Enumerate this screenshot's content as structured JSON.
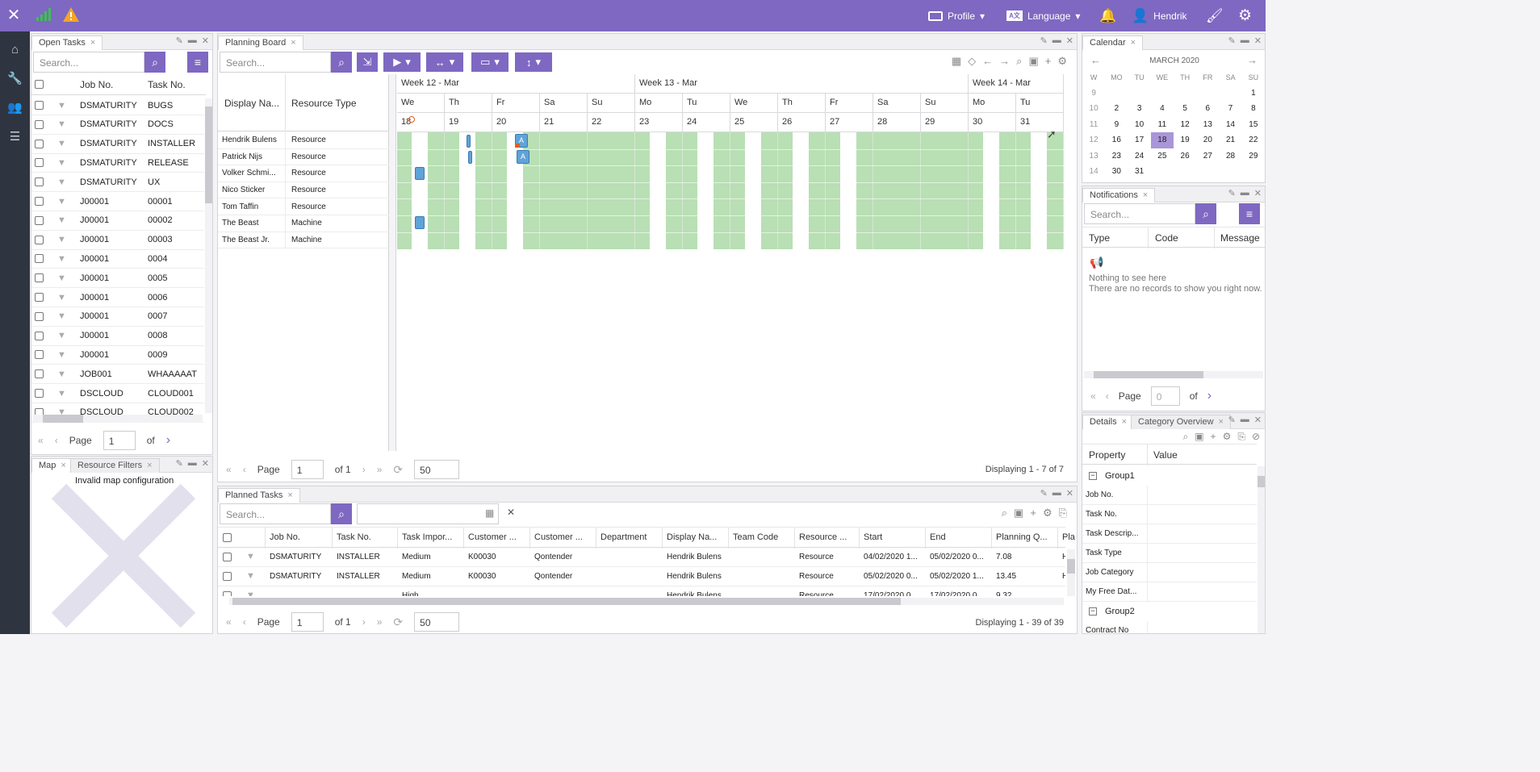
{
  "topbar": {
    "profile": "Profile",
    "language": "Language",
    "user": "Hendrik",
    "accent": "#7e68c2"
  },
  "open_tasks": {
    "title": "Open Tasks",
    "search_placeholder": "Search...",
    "columns": [
      "Job No.",
      "Task No."
    ],
    "rows": [
      [
        "DSMATURITY",
        "BUGS"
      ],
      [
        "DSMATURITY",
        "DOCS"
      ],
      [
        "DSMATURITY",
        "INSTALLER"
      ],
      [
        "DSMATURITY",
        "RELEASE"
      ],
      [
        "DSMATURITY",
        "UX"
      ],
      [
        "J00001",
        "00001"
      ],
      [
        "J00001",
        "00002"
      ],
      [
        "J00001",
        "00003"
      ],
      [
        "J00001",
        "0004"
      ],
      [
        "J00001",
        "0005"
      ],
      [
        "J00001",
        "0006"
      ],
      [
        "J00001",
        "0007"
      ],
      [
        "J00001",
        "0008"
      ],
      [
        "J00001",
        "0009"
      ],
      [
        "JOB001",
        "WHAAAAAT"
      ],
      [
        "DSCLOUD",
        "CLOUD001"
      ],
      [
        "DSCLOUD",
        "CLOUD002"
      ]
    ],
    "pager": {
      "page_label": "Page",
      "page": "1",
      "of": "of"
    }
  },
  "map": {
    "tab1": "Map",
    "tab2": "Resource Filters",
    "message": "Invalid map configuration"
  },
  "planning": {
    "title": "Planning Board",
    "search_placeholder": "Search...",
    "col_display": "Display Na...",
    "col_type": "Resource Type",
    "weeks": [
      "Week 12 - Mar",
      "Week 13 - Mar",
      "Week 14 - Mar"
    ],
    "days": [
      "We",
      "Th",
      "Fr",
      "Sa",
      "Su",
      "Mo",
      "Tu",
      "We",
      "Th",
      "Fr",
      "Sa",
      "Su",
      "Mo",
      "Tu"
    ],
    "dates": [
      "18",
      "19",
      "20",
      "21",
      "22",
      "23",
      "24",
      "25",
      "26",
      "27",
      "28",
      "29",
      "30",
      "31"
    ],
    "resources": [
      [
        "Hendrik Bulens",
        "Resource"
      ],
      [
        "Patrick Nijs",
        "Resource"
      ],
      [
        "Volker Schmi...",
        "Resource"
      ],
      [
        "Nico Sticker",
        "Resource"
      ],
      [
        "Tom Taffin",
        "Resource"
      ],
      [
        "The Beast",
        "Machine"
      ],
      [
        "The Beast Jr.",
        "Machine"
      ]
    ],
    "pager": {
      "page_label": "Page",
      "page": "1",
      "of": "of 1",
      "size": "50",
      "status": "Displaying 1 - 7 of 7"
    },
    "block_label": "A"
  },
  "calendar": {
    "title": "Calendar",
    "month": "MARCH 2020",
    "dow": [
      "W",
      "MO",
      "TU",
      "WE",
      "TH",
      "FR",
      "SA",
      "SU"
    ],
    "weeks": [
      [
        "9",
        "",
        "",
        "",
        "",
        "",
        "",
        "1"
      ],
      [
        "10",
        "2",
        "3",
        "4",
        "5",
        "6",
        "7",
        "8"
      ],
      [
        "11",
        "9",
        "10",
        "11",
        "12",
        "13",
        "14",
        "15"
      ],
      [
        "12",
        "16",
        "17",
        "18",
        "19",
        "20",
        "21",
        "22"
      ],
      [
        "13",
        "23",
        "24",
        "25",
        "26",
        "27",
        "28",
        "29"
      ],
      [
        "14",
        "30",
        "31",
        "",
        "",
        "",
        "",
        ""
      ]
    ],
    "selected": "18"
  },
  "notifications": {
    "title": "Notifications",
    "search_placeholder": "Search...",
    "columns": [
      "Type",
      "Code",
      "Message"
    ],
    "empty_title": "Nothing to see here",
    "empty_sub": "There are no records to show you right now.",
    "pager": {
      "page_label": "Page",
      "page": "0",
      "of": "of"
    }
  },
  "details": {
    "tab1": "Details",
    "tab2": "Category Overview",
    "columns": [
      "Property",
      "Value"
    ],
    "group1": "Group1",
    "group2": "Group2",
    "props": [
      "Job No.",
      "Task No.",
      "Task Descrip...",
      "Task Type",
      "Job Category",
      "My Free Dat..."
    ],
    "props2": [
      "Contract No"
    ]
  },
  "planned": {
    "title": "Planned Tasks",
    "search_placeholder": "Search...",
    "columns": [
      "Job No.",
      "Task No.",
      "Task Impor...",
      "Customer ...",
      "Customer ...",
      "Department",
      "Display Na...",
      "Team Code",
      "Resource ...",
      "Start",
      "End",
      "Planning Q...",
      "Pla"
    ],
    "rows": [
      [
        "DSMATURITY",
        "INSTALLER",
        "Medium",
        "K00030",
        "Qontender",
        "",
        "Hendrik Bulens",
        "",
        "Resource",
        "04/02/2020 1...",
        "05/02/2020 0...",
        "7.08",
        "H"
      ],
      [
        "DSMATURITY",
        "INSTALLER",
        "Medium",
        "K00030",
        "Qontender",
        "",
        "Hendrik Bulens",
        "",
        "Resource",
        "05/02/2020 0...",
        "05/02/2020 1...",
        "13.45",
        "H"
      ],
      [
        "",
        "",
        "High",
        "",
        "",
        "",
        "Hendrik Bulens",
        "",
        "Resource",
        "17/02/2020 0...",
        "17/02/2020 0...",
        "9.32",
        ""
      ]
    ],
    "pager": {
      "page_label": "Page",
      "page": "1",
      "of": "of 1",
      "size": "50",
      "status": "Displaying 1 - 39 of 39"
    }
  }
}
